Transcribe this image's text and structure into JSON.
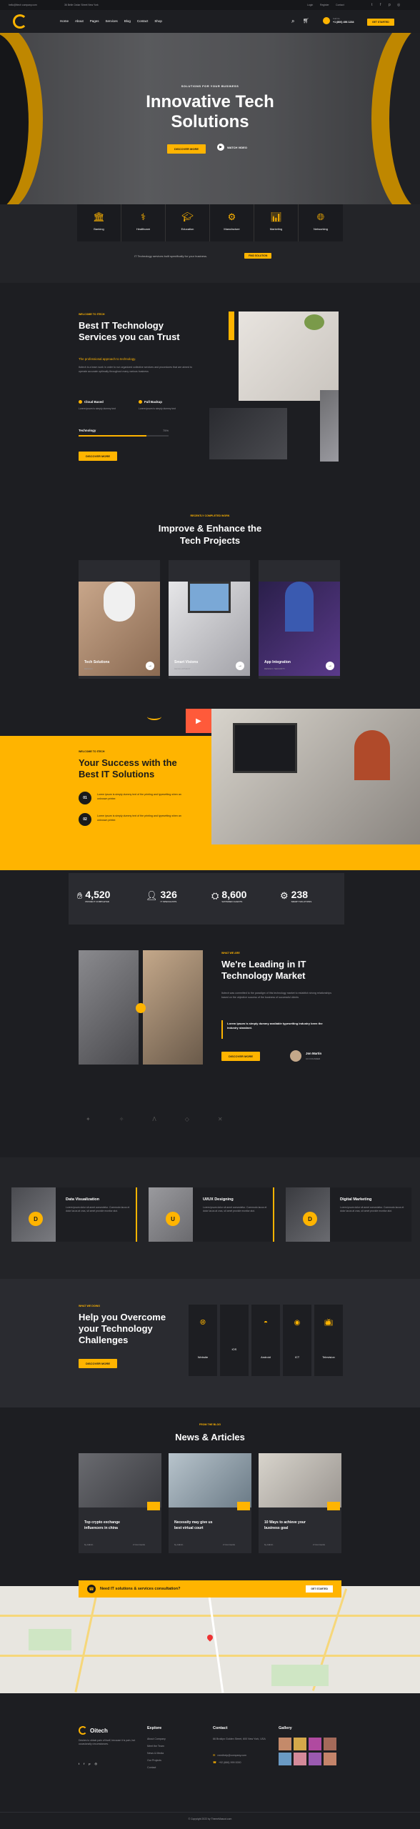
{
  "topbar": {
    "email": "hello@Itech company.com",
    "address": "36 Belle Cedar Street New York",
    "links": [
      "Login",
      "Register",
      "Contact"
    ]
  },
  "nav": {
    "items": [
      "Home",
      "About",
      "Pages",
      "Services",
      "Blog",
      "Contact",
      "Shop"
    ],
    "phone_label": "Call Us",
    "phone": "+1 (800) 456 1234",
    "cta": "GET STARTED"
  },
  "hero": {
    "eyebrow": "SOLUTIONS FOR YOUR BUSINESS",
    "title_line1": "Innovative Tech",
    "title_line2": "Solutions",
    "primary_btn": "DISCOVER MORE",
    "video_label": "WATCH VIDEO"
  },
  "industries": [
    {
      "label": "Banking",
      "icon": "bank-icon"
    },
    {
      "label": "Healthcare",
      "icon": "healthcare-icon"
    },
    {
      "label": "Education",
      "icon": "education-icon"
    },
    {
      "label": "Manufacture",
      "icon": "manufacture-icon"
    },
    {
      "label": "Marketing",
      "icon": "marketing-icon"
    },
    {
      "label": "Networking",
      "icon": "networking-icon"
    }
  ],
  "industries_note": "IT Technology services built specifically for your business.",
  "industries_btn": "FIND SOLUTION",
  "about": {
    "eyebrow": "WELCOME TO ITECH",
    "title_line1": "Best IT Technology",
    "title_line2": "Services you can Trust",
    "subtitle": "The professional approach to technology.",
    "body": "Itotech is a team work in order to run organized collective services and procedures that are aimed to operate accurate optimally throughout many various business",
    "feature1": "Cloud Based",
    "feature1_text": "Lorem ipsum is simply dummy text",
    "feature2": "Full Backup",
    "feature2_text": "Lorem ipsum is simply dummy text",
    "skill_label": "Technology",
    "skill_value": "75%",
    "skill_fill": 0.75,
    "btn": "DISCOVER MORE"
  },
  "projects": {
    "eyebrow": "RECENTLY COMPLETED WORK",
    "title_line1": "Improve & Enhance the",
    "title_line2": "Tech Projects",
    "items": [
      {
        "title": "Tech Solutions",
        "tag": "DESIGN"
      },
      {
        "title": "Smart Visions",
        "tag": "DEVELOPMENT"
      },
      {
        "title": "App Integration",
        "tag": "DESIGN / SECURITY"
      }
    ]
  },
  "success": {
    "eyebrow": "WELCOME TO ITECH",
    "title_line1": "Your Success with the",
    "title_line2": "Best IT Solutions",
    "point1_num": "01",
    "point1_text": "Lorem ipsum is simply dummy text of the printing and typesetting when an unknown printer.",
    "point2_num": "02",
    "point2_text": "Lorem ipsum is simply dummy text of the printing and typesetting when an unknown printer."
  },
  "stats": [
    {
      "value": "4,520",
      "label": "PROJECT COMPLETED"
    },
    {
      "value": "326",
      "label": "IT SPECIALISTS"
    },
    {
      "value": "8,600",
      "label": "SATISFIED CLIENTS"
    },
    {
      "value": "238",
      "label": "SMART SOLUTIONS"
    }
  ],
  "leading": {
    "eyebrow": "WHAT WE ARE",
    "title_line1": "We're Leading in IT",
    "title_line2": "Technology Market",
    "body": "Itotech was committed to the paradigm of this technology market to establish strong relationships based on the objective success of the business of successful clients",
    "quote": "Lorem ipsum is simply dummy available typesetting industry been the industry standard.",
    "btn": "DISCOVER MORE",
    "author_name": "Jon Martin",
    "author_role": "CO FOUNDER"
  },
  "services": [
    {
      "title": "Data Visualization",
      "letter": "D",
      "text": "Lorem ipsum dolor sit amet consectetur. Commodo lacus et dolor lacus at cras, sit amet provide monitor alot."
    },
    {
      "title": "UI/UX Designing",
      "letter": "U",
      "text": "Lorem ipsum dolor sit amet consectetur. Commodo lacus et dolor lacus at cras, sit amet provide monitor alot."
    },
    {
      "title": "Digital Marketing",
      "letter": "D",
      "text": "Lorem ipsum dolor sit amet consectetur. Commodo lacus et dolor lacus at cras, sit amet provide monitor alot."
    }
  ],
  "platforms": {
    "eyebrow": "WHAT WE DOING",
    "title_line1": "Help you Overcome",
    "title_line2": "your Technology",
    "title_line3": "Challenges",
    "btn": "DISCOVER MORE",
    "items": [
      {
        "label": "Website",
        "icon": "website-icon"
      },
      {
        "label": "iOS",
        "icon": "apple-icon"
      },
      {
        "label": "Android",
        "icon": "android-icon"
      },
      {
        "label": "ICT",
        "icon": "ict-icon"
      },
      {
        "label": "Television",
        "icon": "television-icon"
      }
    ]
  },
  "blog": {
    "eyebrow": "FROM THE BLOG",
    "title": "News & Articles",
    "posts": [
      {
        "title_line1": "Top crypto exchange",
        "title_line2": "influencers in china",
        "author": "by Admin",
        "comments": "2 Comments"
      },
      {
        "title_line1": "Necessity may give us",
        "title_line2": "best virtual court",
        "author": "by Admin",
        "comments": "2 Comments"
      },
      {
        "title_line1": "10 Ways to achieve your",
        "title_line2": "business goal",
        "author": "by Admin",
        "comments": "2 Comments"
      }
    ]
  },
  "consult": {
    "text": "Need IT solutions & services consultation?",
    "btn": "GET STARTED"
  },
  "footer": {
    "brand": "Oitech",
    "about": "Desires to obtain pain of itself, because it is pain, but occasionally circumstances.",
    "explore_title": "Explore",
    "explore": [
      "About Company",
      "Meet the Team",
      "News & Media",
      "Our Projects",
      "Contact"
    ],
    "contact_title": "Contact",
    "contact_address": "66 Broklyn Golden Street, 600 New York, USA",
    "contact_email": "needhelp@company.com",
    "contact_phone": "+92 (666) 999 0000",
    "gallery_title": "Gallery",
    "copyright": "© Copyright 2022 by ThemeMascot.com"
  }
}
